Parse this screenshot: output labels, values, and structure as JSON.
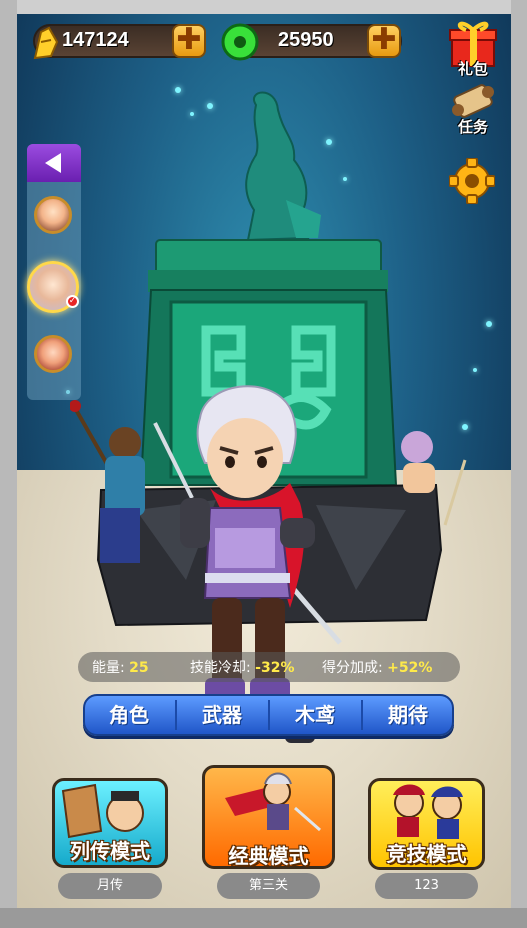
{
  "currency": {
    "gold": "147124",
    "jade": "25950",
    "add_label": "✚"
  },
  "right_menu": {
    "gift_label": "礼包",
    "task_label": "任务"
  },
  "stats": {
    "energy_label": "能量:",
    "energy_value": "25",
    "cooldown_label": "技能冷却:",
    "cooldown_value": "-32%",
    "score_label": "得分加成:",
    "score_value": "+52%"
  },
  "tabs": [
    {
      "label": "角色"
    },
    {
      "label": "武器"
    },
    {
      "label": "木鸢"
    },
    {
      "label": "期待"
    }
  ],
  "modes": [
    {
      "label": "列传模式",
      "sub": "月传"
    },
    {
      "label": "经典模式",
      "sub": "第三关"
    },
    {
      "label": "竞技模式",
      "sub": "123"
    }
  ],
  "colors": {
    "accent_yellow": "#ffea4a",
    "tab_blue": "#2f6fe0",
    "mode1_bg": "#2fd3e8",
    "mode2_bg": "#ff8a14",
    "mode3_bg": "#ffd21e"
  }
}
